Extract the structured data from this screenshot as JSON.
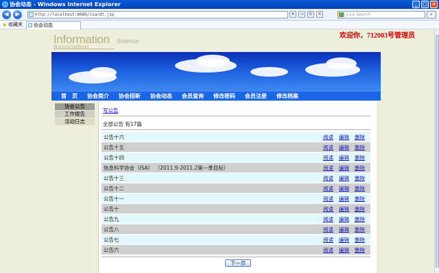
{
  "window": {
    "title": "协会动态 - Windows Internet Explorer"
  },
  "browser": {
    "address": "http://localhost:8080/isa/dt.jsp",
    "search_placeholder": "Live Search",
    "favorites_label": "收藏夹",
    "tab_label": "协会动态"
  },
  "header": {
    "logo_main": "Information",
    "logo_sub": "Science",
    "logo_assoc": "Association",
    "welcome": "欢迎你，712003号管理员"
  },
  "nav": [
    "首　页",
    "协会简介",
    "协会招新",
    "协会动态",
    "会员查询",
    "修改密码",
    "会员注册",
    "修改档案"
  ],
  "sidebar": [
    "协会公告",
    "工作报告",
    "活动日志"
  ],
  "content": {
    "breadcrumb": "写公告",
    "summary": "全部公告 有17篇",
    "rows": [
      "公告十六",
      "公告十五",
      "公告十四",
      "信息科学协会（ISA） （2011.9-2011.2第一季目标）",
      "公告十三",
      "公告十二",
      "公告十一",
      "公告十",
      "公告九",
      "公告八",
      "公告七",
      "公告六"
    ],
    "actions": {
      "read": "阅读",
      "edit": "编辑",
      "delete": "删除"
    },
    "next_button": "下一页"
  },
  "colors": {
    "accent": "#1a66e6",
    "welcome": "#d60000",
    "link": "#1010cc"
  }
}
